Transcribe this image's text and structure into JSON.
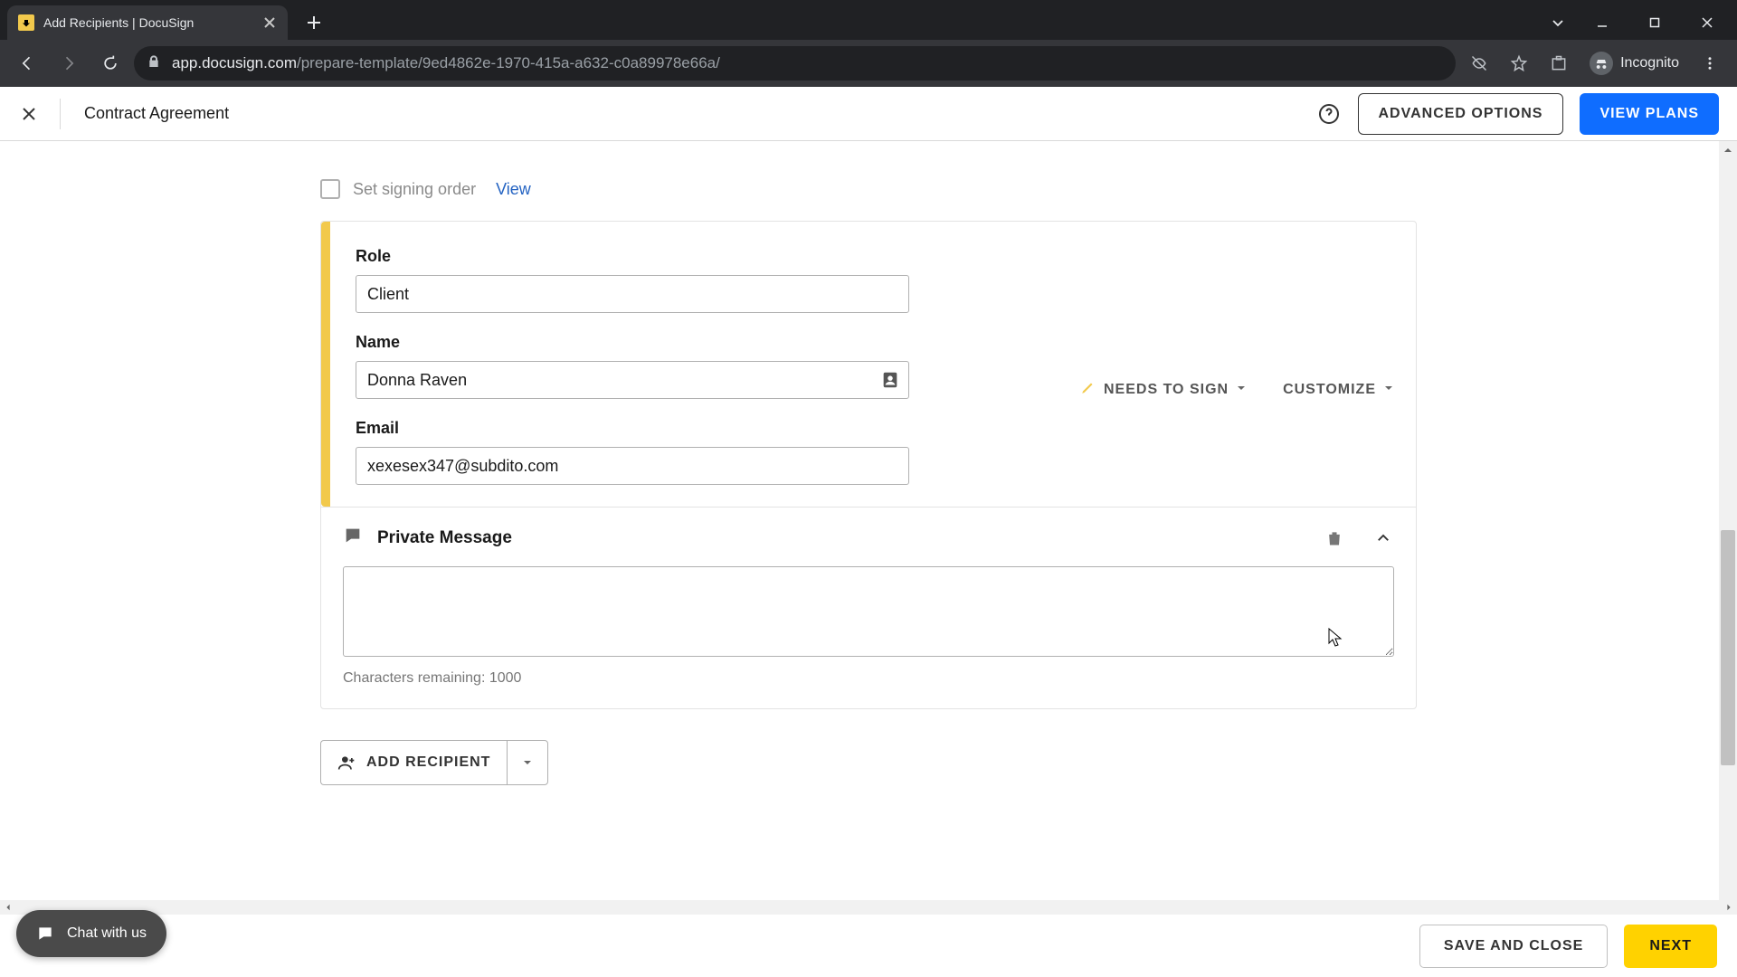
{
  "browser": {
    "tab_title": "Add Recipients | DocuSign",
    "url_host": "app.docusign.com",
    "url_path": "/prepare-template/9ed4862e-1970-415a-a632-c0a89978e66a/",
    "incognito_label": "Incognito"
  },
  "header": {
    "document_title": "Contract Agreement",
    "advanced_options": "ADVANCED OPTIONS",
    "view_plans": "VIEW PLANS"
  },
  "signing": {
    "set_order_label": "Set signing order",
    "view_link": "View"
  },
  "recipient": {
    "role_label": "Role",
    "role_value": "Client",
    "name_label": "Name",
    "name_value": "Donna Raven",
    "email_label": "Email",
    "email_value": "xexesex347@subdito.com",
    "needs_to_sign": "NEEDS TO SIGN",
    "customize": "CUSTOMIZE"
  },
  "private_message": {
    "title": "Private Message",
    "chars_remaining": "Characters remaining: 1000",
    "value": ""
  },
  "add_recipient": {
    "label": "ADD RECIPIENT"
  },
  "footer": {
    "save_close": "SAVE AND CLOSE",
    "next": "NEXT"
  },
  "chat": {
    "label": "Chat with us"
  }
}
